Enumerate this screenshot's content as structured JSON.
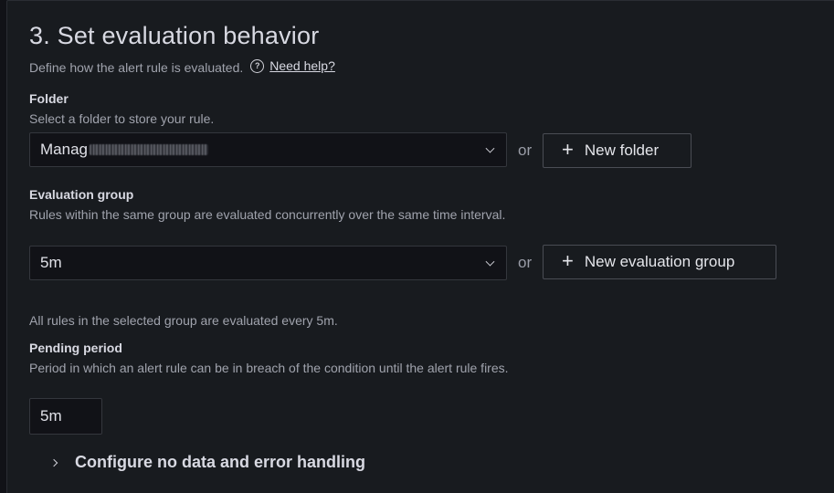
{
  "section": {
    "title": "3. Set evaluation behavior",
    "description": "Define how the alert rule is evaluated.",
    "help_icon": "question-circle-icon",
    "help_link": "Need help?"
  },
  "folder": {
    "label": "Folder",
    "hint": "Select a folder to store your rule.",
    "value_prefix": "Manag",
    "value_redacted": true,
    "or_text": "or",
    "new_button": "New folder"
  },
  "evaluation_group": {
    "label": "Evaluation group",
    "hint": "Rules within the same group are evaluated concurrently over the same time interval.",
    "value": "5m",
    "or_text": "or",
    "new_button": "New evaluation group",
    "info": "All rules in the selected group are evaluated every 5m."
  },
  "pending_period": {
    "label": "Pending period",
    "hint": "Period in which an alert rule can be in breach of the condition until the alert rule fires.",
    "value": "5m"
  },
  "no_data": {
    "label": "Configure no data and error handling",
    "expanded": false
  },
  "colors": {
    "background": "#181b1f",
    "input_background": "#111217",
    "text_primary": "#d8d9e2",
    "text_secondary": "#a0a3ad",
    "border": "#34373d"
  }
}
